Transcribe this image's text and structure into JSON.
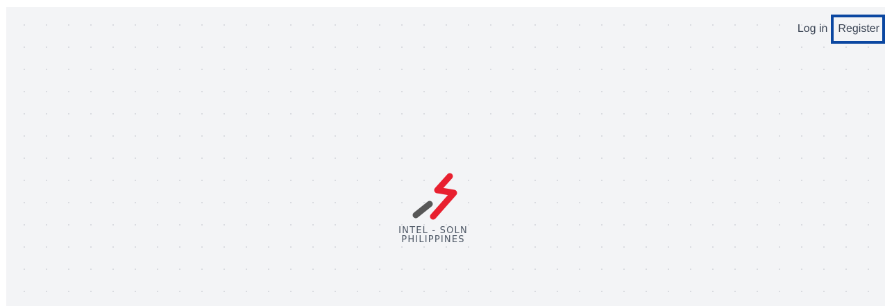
{
  "nav": {
    "login_label": "Log in",
    "register_label": "Register"
  },
  "brand": {
    "line1": "INTEL - SOLN",
    "line2": "PHILIPPINES",
    "colors": {
      "accent_red": "#e8202f",
      "accent_gray": "#575757"
    }
  },
  "colors": {
    "background": "#f3f4f6",
    "focus_outline": "#0b47a1",
    "nav_text": "#374151"
  }
}
